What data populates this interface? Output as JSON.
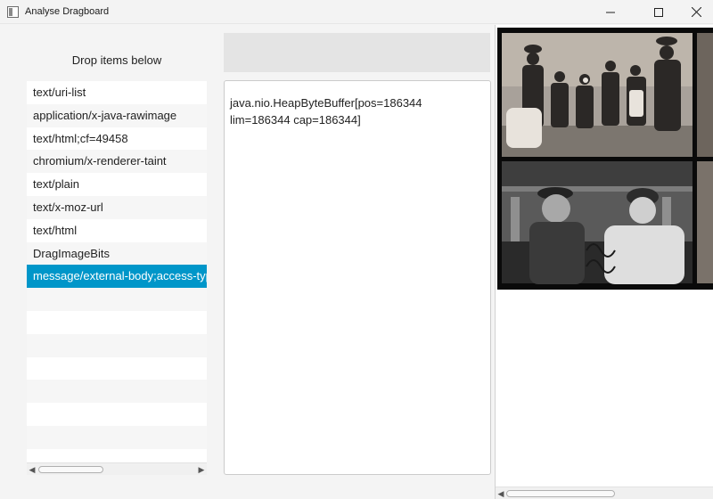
{
  "window": {
    "title": "Analyse Dragboard"
  },
  "left_panel": {
    "drop_label": "Drop items below",
    "items": [
      {
        "label": "text/uri-list",
        "selected": false
      },
      {
        "label": "application/x-java-rawimage",
        "selected": false
      },
      {
        "label": "text/html;cf=49458",
        "selected": false
      },
      {
        "label": "chromium/x-renderer-taint",
        "selected": false
      },
      {
        "label": "text/plain",
        "selected": false
      },
      {
        "label": "text/x-moz-url",
        "selected": false
      },
      {
        "label": "text/html",
        "selected": false
      },
      {
        "label": "DragImageBits",
        "selected": false
      },
      {
        "label": "message/external-body;access-type",
        "selected": true
      }
    ],
    "empty_rows": 8
  },
  "middle_panel": {
    "content_text": "java.nio.HeapByteBuffer[pos=186344 lim=186344 cap=186344]"
  },
  "colors": {
    "selection": "#0096c9",
    "window_bg": "#f4f4f4"
  },
  "icons": {
    "app": "app-window-icon",
    "minimize": "minimize-icon",
    "maximize": "maximize-icon",
    "close": "close-icon"
  }
}
